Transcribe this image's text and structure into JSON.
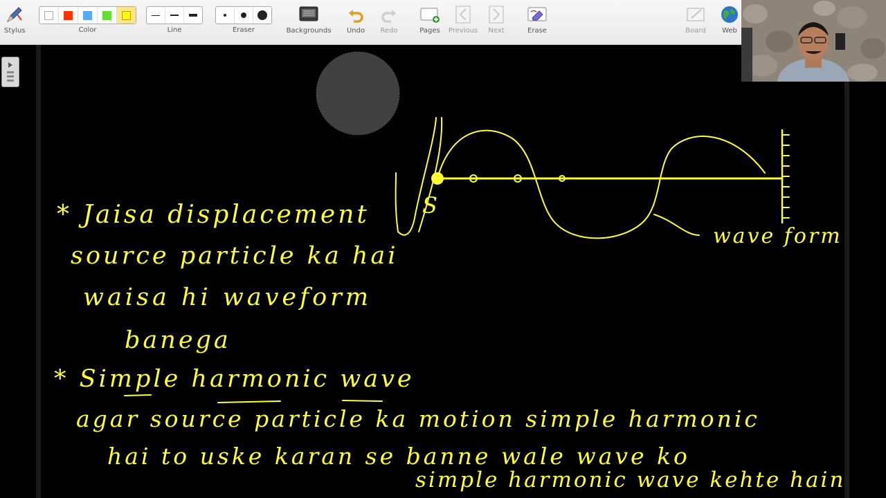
{
  "toolbar": {
    "stylus_label": "Stylus",
    "color_label": "Color",
    "line_label": "Line",
    "eraser_label": "Eraser",
    "backgrounds_label": "Backgrounds",
    "undo_label": "Undo",
    "redo_label": "Redo",
    "pages_label": "Pages",
    "previous_label": "Previous",
    "next_label": "Next",
    "erase_label": "Erase",
    "board_label": "Board",
    "web_label": "Web",
    "colors": [
      "#ffffff",
      "#ff3300",
      "#55aaff",
      "#66dd33",
      "#ffff00"
    ],
    "selected_color": "#ffff00"
  },
  "ink_color": "#ffff33",
  "whiteboard": {
    "line1": "* Jaisa displacement",
    "line2": "source particle ka hai",
    "line3": "waisa hi waveform",
    "line4": "banega",
    "line5": "* Simple harmonic wave",
    "line6": "agar source particle ka motion simple harmonic",
    "line7": "hai to uske karan se banne wale wave ko",
    "line8": "simple harmonic wave kehte hain",
    "diagram_source_label": "S",
    "diagram_wave_label": "wave form"
  }
}
